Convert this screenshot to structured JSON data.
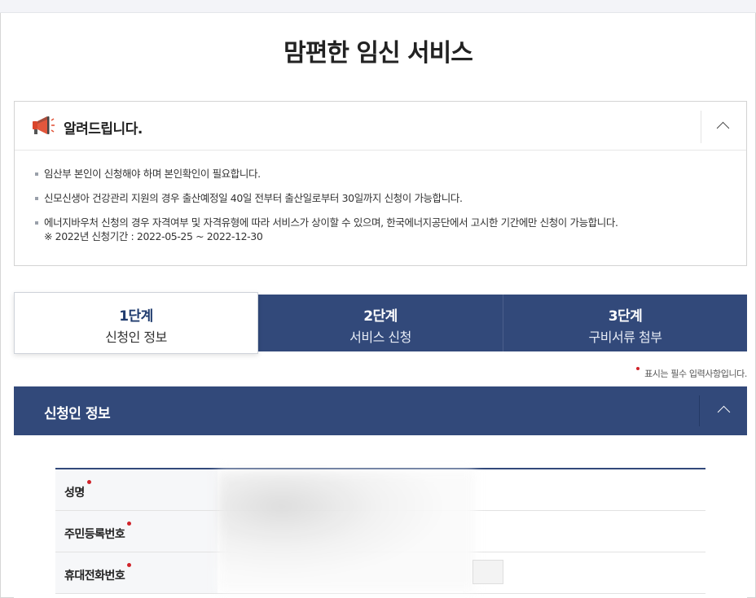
{
  "page": {
    "title": "맘편한 임신 서비스"
  },
  "notice": {
    "title": "알려드립니다.",
    "icon": "megaphone-icon",
    "items": [
      {
        "text": "임산부 본인이 신청해야 하며 본인확인이 필요합니다."
      },
      {
        "text": "신모신생아 건강관리 지원의 경우 출산예정일 40일 전부터 출산일로부터 30일까지 신청이 가능합니다."
      },
      {
        "text": "에너지바우처 신청의 경우 자격여부 및 자격유형에 따라 서비스가 상이할 수 있으며, 한국에너지공단에서 고시한 기간에만 신청이 가능합니다.",
        "sub": "※ 2022년 신청기간 : 2022-05-25 ~ 2022-12-30"
      }
    ]
  },
  "steps": [
    {
      "num": "1단계",
      "name": "신청인 정보",
      "active": true
    },
    {
      "num": "2단계",
      "name": "서비스 신청",
      "active": false
    },
    {
      "num": "3단계",
      "name": "구비서류 첨부",
      "active": false
    }
  ],
  "required_note": "표시는 필수 입력사항입니다.",
  "section": {
    "title": "신청인 정보"
  },
  "form": {
    "rows": [
      {
        "label": "성명",
        "required": true
      },
      {
        "label": "주민등록번호",
        "required": true
      },
      {
        "label": "휴대전화번호",
        "required": true
      }
    ]
  },
  "colors": {
    "primary": "#32497a",
    "required": "#d0232a"
  }
}
